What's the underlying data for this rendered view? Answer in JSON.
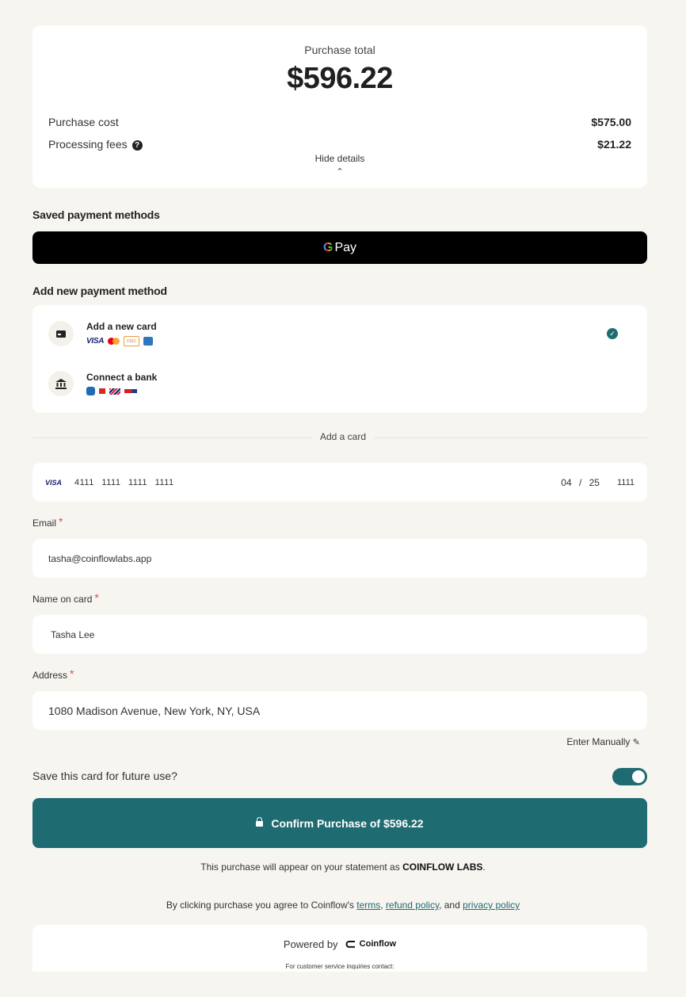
{
  "summary": {
    "total_label": "Purchase total",
    "total_amount": "$596.22",
    "rows": [
      {
        "label": "Purchase cost",
        "value": "$575.00"
      },
      {
        "label": "Processing fees",
        "value": "$21.22"
      }
    ],
    "toggle_label": "Hide details",
    "help_icon": "question-circle-icon",
    "chevron_icon": "chevron-up-icon"
  },
  "saved": {
    "title": "Saved payment methods",
    "gpay_g": "G",
    "gpay_label": "Pay"
  },
  "add_method": {
    "title": "Add new payment method",
    "options": [
      {
        "label": "Add a new card",
        "icon": "card-icon",
        "logos": [
          "VISA",
          "mastercard",
          "discover",
          "amex"
        ],
        "selected": true
      },
      {
        "label": "Connect a bank",
        "icon": "bank-icon",
        "logos": [
          "chase",
          "bank",
          "bank-of-america",
          "wells-fargo"
        ],
        "selected": false
      }
    ]
  },
  "card_section": {
    "divider_label": "Add a card",
    "card_brand": "VISA",
    "card_number": "4111 1111 1111 1111",
    "expiry": "04 / 25",
    "cvv": "1111"
  },
  "form": {
    "email_label": "Email",
    "email_value": "tasha@coinflowlabs.app",
    "name_label": "Name on card",
    "name_value": "Tasha Lee",
    "address_label": "Address",
    "address_value": "1080 Madison Avenue, New York, NY, USA",
    "required_mark": "*",
    "enter_manually": "Enter Manually",
    "enter_manually_icon": "pencil-icon"
  },
  "save_card": {
    "label": "Save this card for future use?",
    "enabled": true
  },
  "confirm_button": {
    "label": "Confirm Purchase of $596.22",
    "icon": "lock-icon"
  },
  "statement": {
    "prefix": "This purchase will appear on your statement as ",
    "name": "COINFLOW LABS",
    "suffix": "."
  },
  "agreement": {
    "prefix": "By clicking purchase you agree to Coinflow's ",
    "terms": "terms",
    "sep1": ", ",
    "refund": "refund policy",
    "sep2": ", and ",
    "privacy": "privacy policy"
  },
  "footer": {
    "powered_by": "Powered by",
    "brand": "Coinflow",
    "customer_service": "For customer service inquiries contact:"
  },
  "colors": {
    "accent": "#1f6b72",
    "background": "#f6f5f0",
    "required": "#e5484d"
  }
}
